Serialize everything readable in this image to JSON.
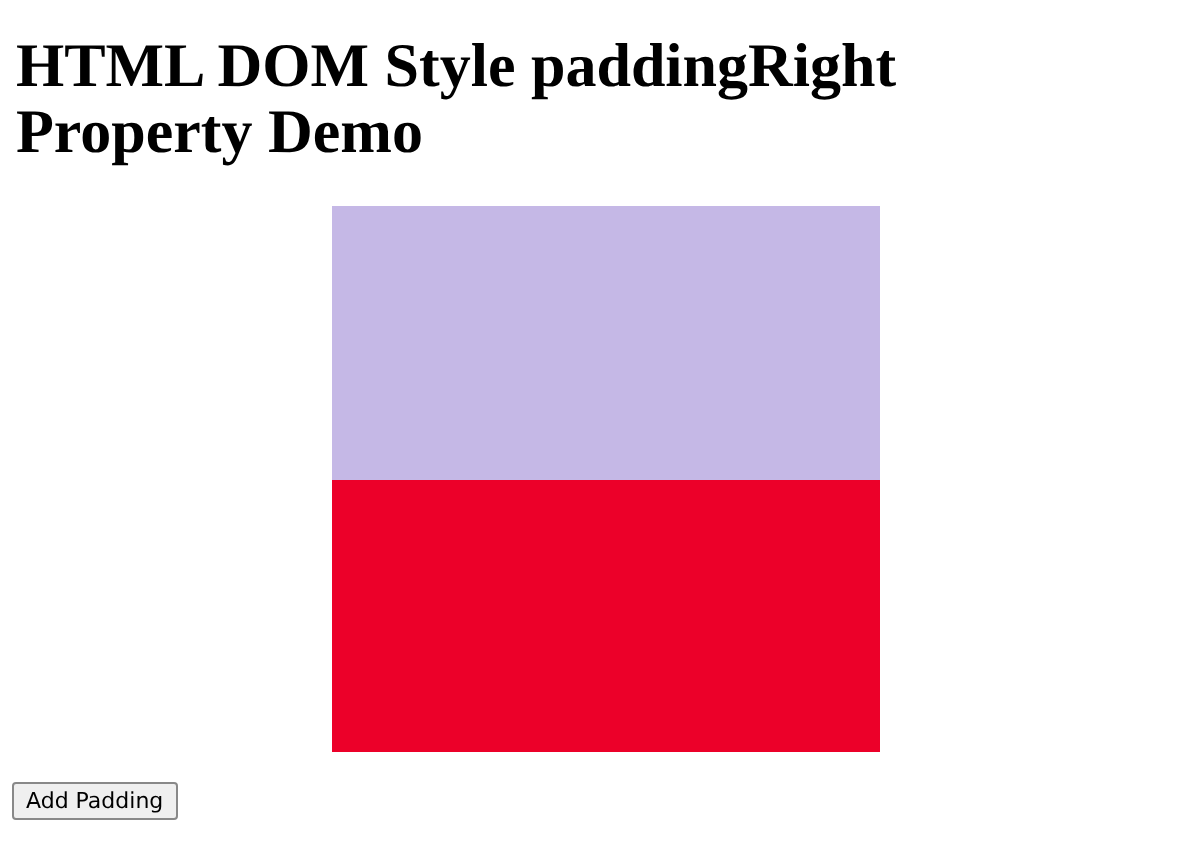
{
  "heading": "HTML DOM Style paddingRight Property Demo",
  "button": {
    "label": "Add Padding"
  }
}
